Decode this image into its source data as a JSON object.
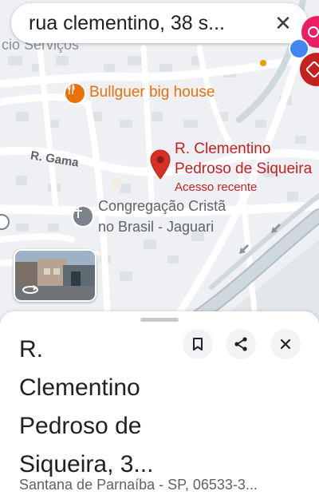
{
  "search": {
    "query": "rua clementino, 38 s..."
  },
  "map": {
    "labels": {
      "partial_services": "cio Serviços",
      "restaurant": "Bullguer big house",
      "street_gama": "R. Gama",
      "pin_title_line1": "R. Clementino",
      "pin_title_line2": "Pedroso de Siqueira",
      "pin_subtitle": "Acesso recente",
      "church_line1": "Congregação Cristã",
      "church_line2": "no Brasil - Jaguari"
    },
    "colors": {
      "pin": "#d93025",
      "restaurant": "#e8710a",
      "church": "#5f6368"
    }
  },
  "place": {
    "title_lines": [
      "R.",
      "Clementino",
      "Pedroso de",
      "Siqueira, 3..."
    ],
    "address": "Santana de Parnaíba - SP, 06533-3..."
  },
  "icons": {
    "save": "bookmark-icon",
    "share": "share-icon",
    "close": "close-icon",
    "street_view": "street-view-thumbnail"
  }
}
